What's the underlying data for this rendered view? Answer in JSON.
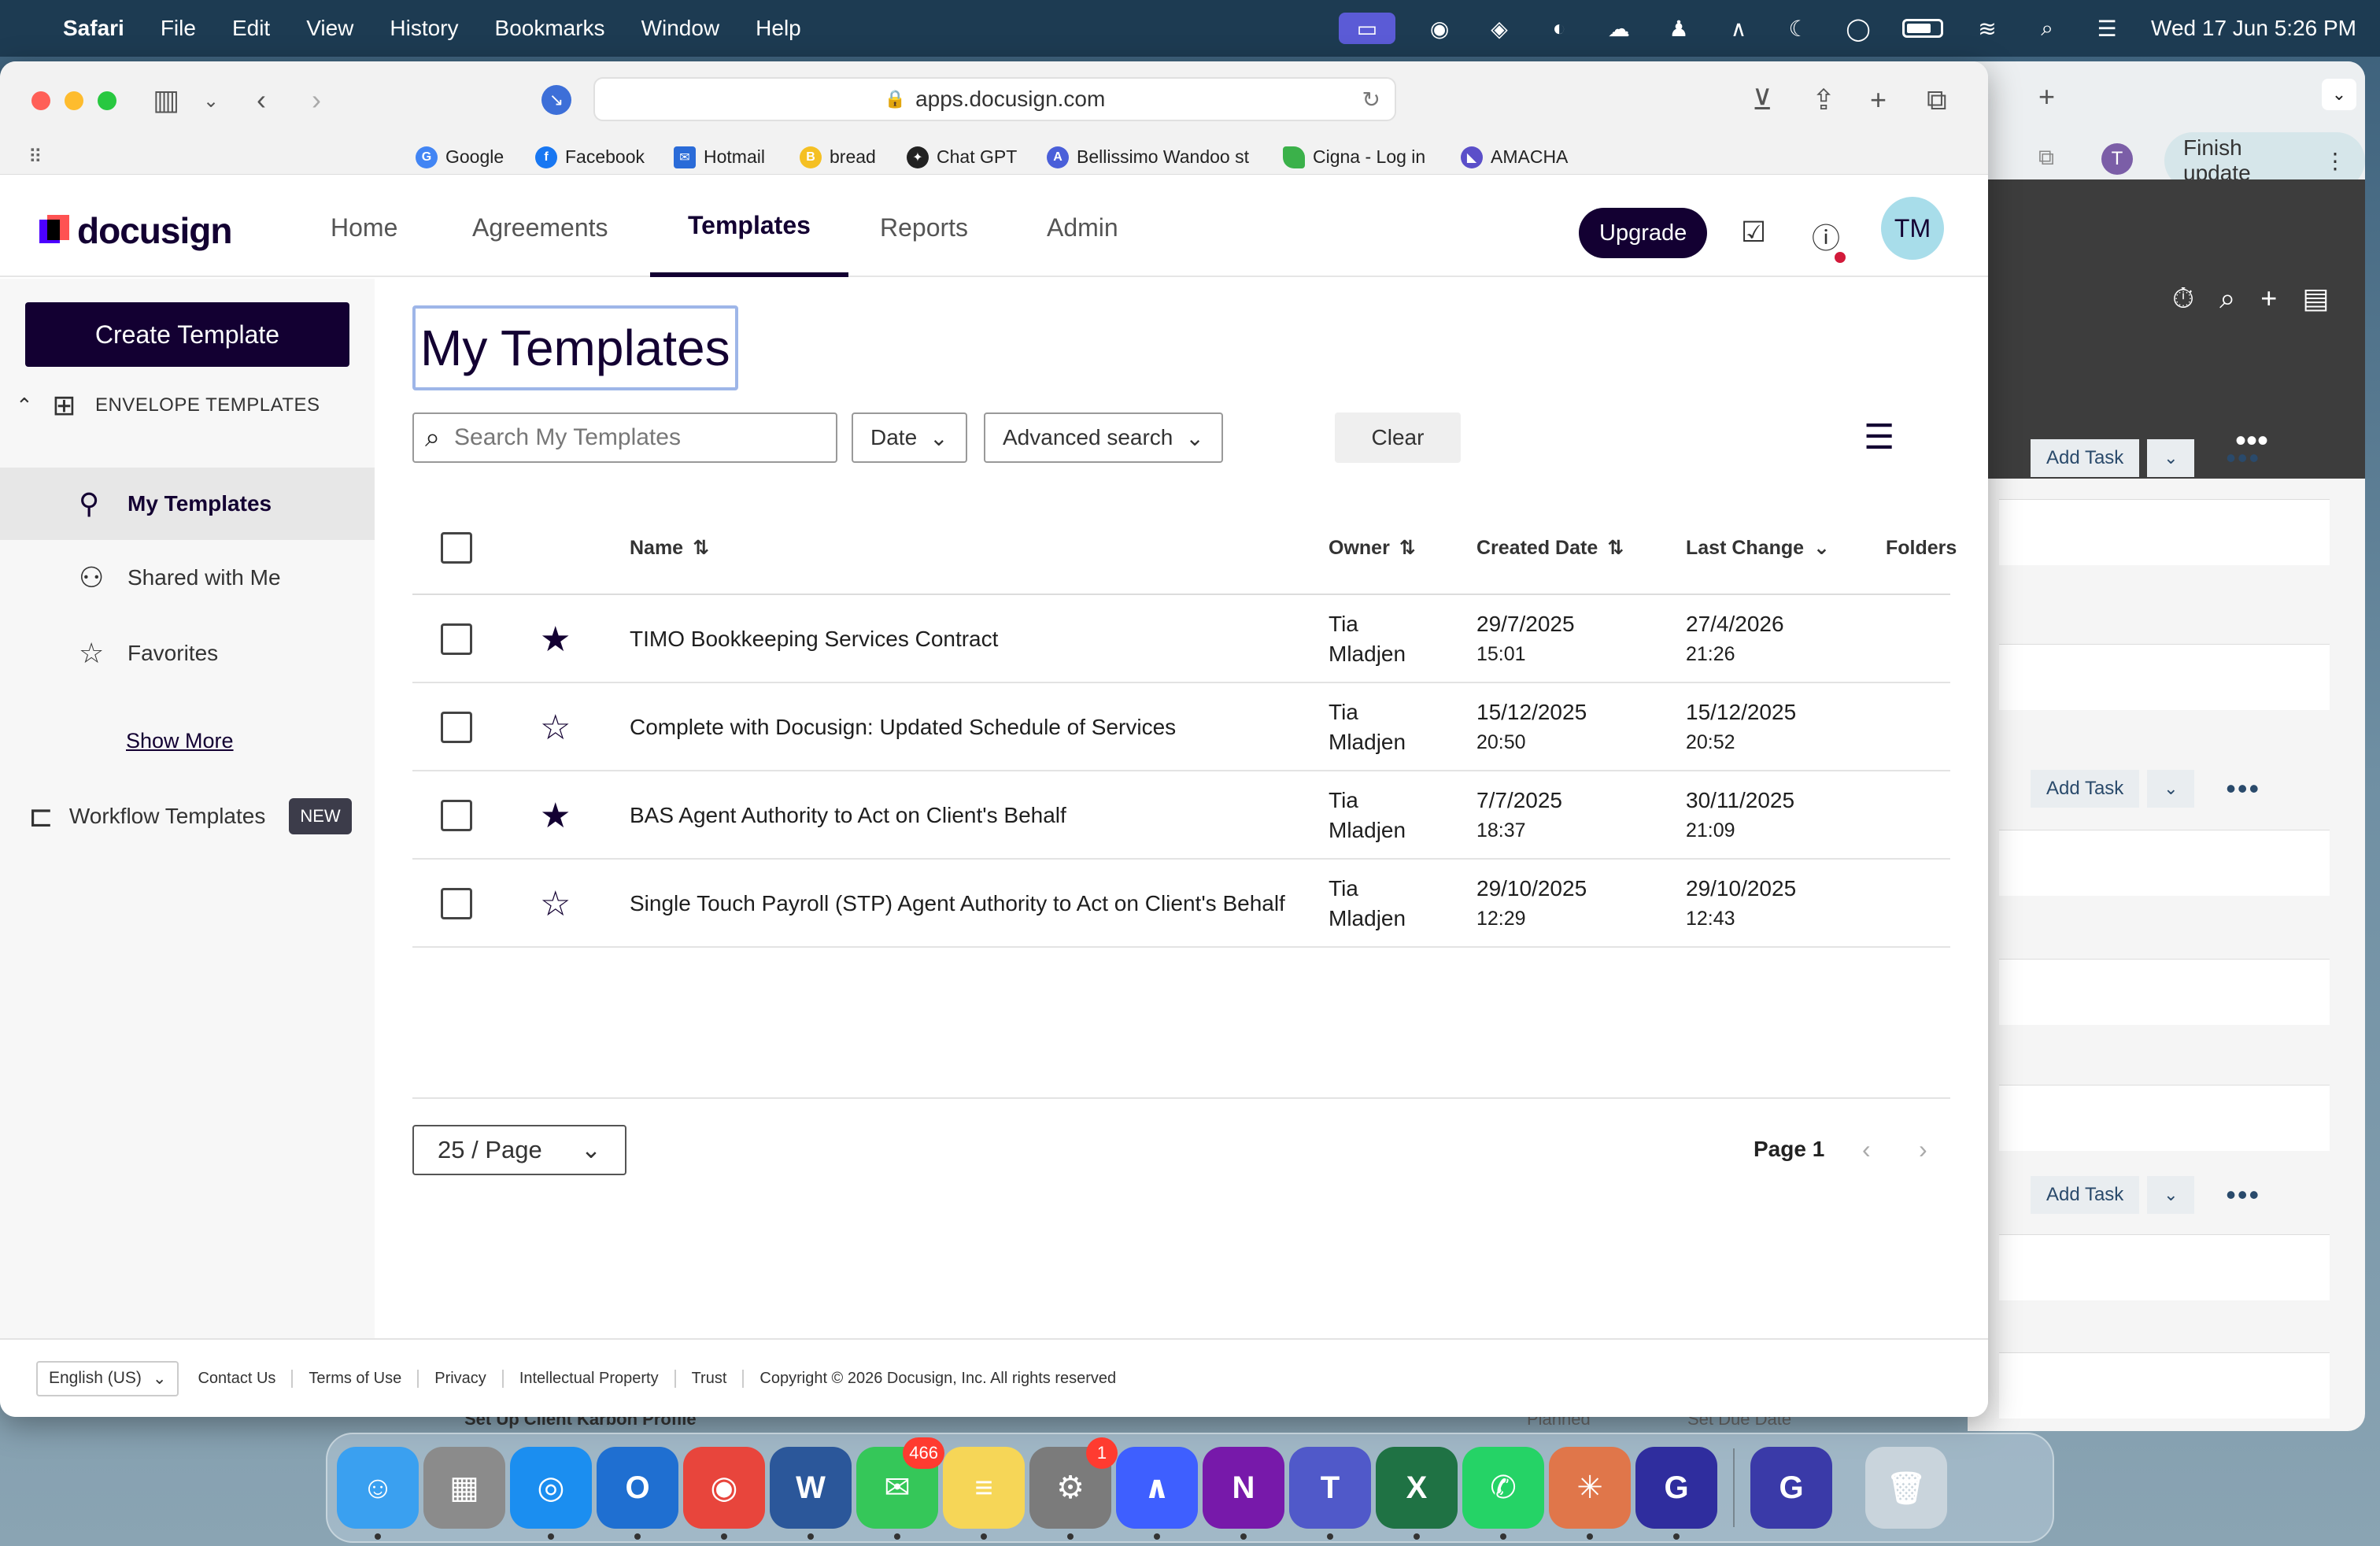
{
  "menubar": {
    "app": "Safari",
    "items": [
      "File",
      "Edit",
      "View",
      "History",
      "Bookmarks",
      "Window",
      "Help"
    ],
    "datetime": "Wed 17 Jun  5:26 PM"
  },
  "browser": {
    "url": "apps.docusign.com",
    "bookmarks": [
      {
        "label": "Google",
        "icon": "google-icon",
        "color": "#4285f4"
      },
      {
        "label": "Facebook",
        "icon": "facebook-icon",
        "color": "#1877f2"
      },
      {
        "label": "Hotmail",
        "icon": "hotmail-icon",
        "color": "#2a6bd8"
      },
      {
        "label": "bread",
        "icon": "bread-icon",
        "color": "#f5c023"
      },
      {
        "label": "Chat GPT",
        "icon": "openai-icon",
        "color": "#222222"
      },
      {
        "label": "Bellissimo Wandoo st",
        "icon": "letter-a-icon",
        "color": "#4a5fd9"
      },
      {
        "label": "Cigna - Log in",
        "icon": "leaf-icon",
        "color": "#3bb14a"
      },
      {
        "label": "AMACHA",
        "icon": "amacha-icon",
        "color": "#5b4fc9"
      }
    ]
  },
  "background_window": {
    "finish_update": "Finish update",
    "avatar_letter": "T",
    "add_task": "Add Task",
    "bottom_text": "Set Up Client Karbon Profile",
    "bottom_status": "Planned",
    "bottom_due": "Set Due Date"
  },
  "app": {
    "logo": "docusign",
    "nav": [
      "Home",
      "Agreements",
      "Templates",
      "Reports",
      "Admin"
    ],
    "active_nav": "Templates",
    "upgrade": "Upgrade",
    "avatar": "TM",
    "colors": {
      "primary": "#130032",
      "accent": "#4c00ff",
      "logo_red": "#ff5252"
    }
  },
  "sidebar": {
    "create": "Create Template",
    "section": "ENVELOPE TEMPLATES",
    "items": [
      {
        "label": "My Templates",
        "icon": "person-icon",
        "active": true
      },
      {
        "label": "Shared with Me",
        "icon": "people-icon",
        "active": false
      },
      {
        "label": "Favorites",
        "icon": "star-icon",
        "active": false
      }
    ],
    "show_more": "Show More",
    "workflow": "Workflow Templates",
    "new_badge": "NEW"
  },
  "main": {
    "title": "My Templates",
    "search_placeholder": "Search My Templates",
    "date_filter": "Date",
    "advanced_search": "Advanced search",
    "clear": "Clear",
    "columns": {
      "name": "Name",
      "owner": "Owner",
      "created": "Created Date",
      "last_change": "Last Change",
      "folders": "Folders"
    },
    "rows": [
      {
        "name": "TIMO Bookkeeping Services Contract",
        "owner_first": "Tia",
        "owner_last": "Mladjen",
        "created_date": "29/7/2025",
        "created_time": "15:01",
        "changed_date": "27/4/2026",
        "changed_time": "21:26",
        "favorite": true
      },
      {
        "name": "Complete with Docusign: Updated Schedule of Services",
        "owner_first": "Tia",
        "owner_last": "Mladjen",
        "created_date": "15/12/2025",
        "created_time": "20:50",
        "changed_date": "15/12/2025",
        "changed_time": "20:52",
        "favorite": false
      },
      {
        "name": "BAS Agent Authority to Act on Client's Behalf",
        "owner_first": "Tia",
        "owner_last": "Mladjen",
        "created_date": "7/7/2025",
        "created_time": "18:37",
        "changed_date": "30/11/2025",
        "changed_time": "21:09",
        "favorite": true
      },
      {
        "name": "Single Touch Payroll (STP) Agent Authority to Act on Client's Behalf",
        "owner_first": "Tia",
        "owner_last": "Mladjen",
        "created_date": "29/10/2025",
        "created_time": "12:29",
        "changed_date": "29/10/2025",
        "changed_time": "12:43",
        "favorite": false
      }
    ],
    "per_page": "25 / Page",
    "page_label": "Page 1"
  },
  "footer": {
    "language": "English (US)",
    "links": [
      "Contact Us",
      "Terms of Use",
      "Privacy",
      "Intellectual Property",
      "Trust"
    ],
    "copyright": "Copyright © 2026 Docusign, Inc. All rights reserved"
  },
  "dock": {
    "apps": [
      {
        "name": "finder-icon",
        "color": "#3aa0f0",
        "glyph": "☺"
      },
      {
        "name": "launchpad-icon",
        "color": "#8b8b8b",
        "glyph": "▦"
      },
      {
        "name": "safari-icon",
        "color": "#1b8ef0",
        "glyph": "◎"
      },
      {
        "name": "outlook-icon",
        "color": "#1f6fd1",
        "glyph": "O"
      },
      {
        "name": "chrome-icon",
        "color": "#e8453c",
        "glyph": "◉"
      },
      {
        "name": "word-icon",
        "color": "#2b579a",
        "glyph": "W"
      },
      {
        "name": "messages-icon",
        "color": "#35c759",
        "glyph": "✉",
        "badge": "466"
      },
      {
        "name": "notes-icon",
        "color": "#f6d657",
        "glyph": "≡"
      },
      {
        "name": "settings-icon",
        "color": "#7b7b7b",
        "glyph": "⚙",
        "badge": "1"
      },
      {
        "name": "nordvpn-icon",
        "color": "#3e5fff",
        "glyph": "∧"
      },
      {
        "name": "onenote-icon",
        "color": "#7719aa",
        "glyph": "N"
      },
      {
        "name": "teams-icon",
        "color": "#5059c9",
        "glyph": "T"
      },
      {
        "name": "excel-icon",
        "color": "#1f7244",
        "glyph": "X"
      },
      {
        "name": "whatsapp-icon",
        "color": "#25d366",
        "glyph": "✆"
      },
      {
        "name": "claude-icon",
        "color": "#e0764a",
        "glyph": "✳"
      },
      {
        "name": "grammarly-icon",
        "color": "#2f2d9e",
        "glyph": "G"
      },
      {
        "name": "grammarly-doc-icon",
        "color": "#3a3aa8",
        "glyph": "G"
      },
      {
        "name": "trash-icon",
        "color": "#c9d4dc",
        "glyph": "🗑"
      }
    ]
  }
}
